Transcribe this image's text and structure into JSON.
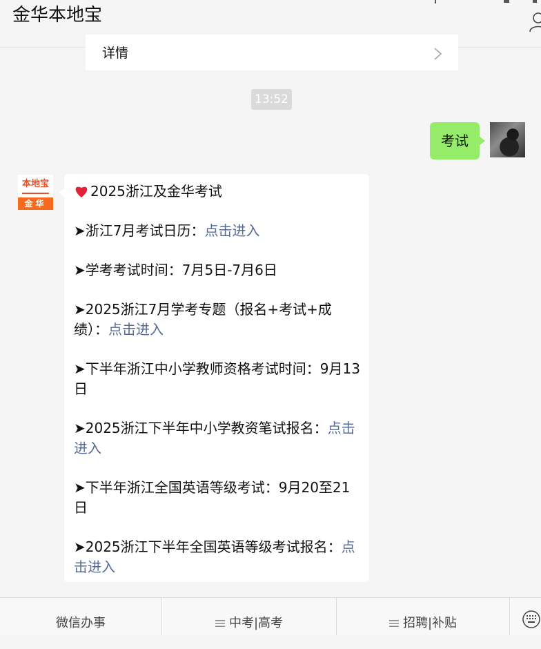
{
  "header": {
    "title": "金华本地宝",
    "profile_icon": "person-icon"
  },
  "details_card": {
    "label": "详情",
    "chevron_icon": "chevron-right-icon"
  },
  "timestamp": "13:52",
  "user_message": {
    "text": "考试",
    "bubble_color": "#95ec69"
  },
  "bot": {
    "avatar_top": "本地宝",
    "avatar_bottom": "金华",
    "heading_icon": "heart-icon",
    "heading": "2025浙江及金华考试",
    "items": [
      {
        "text": "➤浙江7月考试日历：",
        "link": "点击进入"
      },
      {
        "text": "➤学考考试时间：7月5日-7月6日",
        "link": ""
      },
      {
        "text": "➤2025浙江7月学考专题（报名+考试+成绩）：",
        "link": "点击进入"
      },
      {
        "text": "➤下半年浙江中小学教师资格考试时间：9月13日",
        "link": ""
      },
      {
        "text": "➤2025浙江下半年中小学教资笔试报名：",
        "link": "点击进入"
      },
      {
        "text": "➤下半年浙江全国英语等级考试：9月20至21日",
        "link": ""
      },
      {
        "text": "➤2025浙江下半年全国英语等级考试报名：",
        "link": "点击进入"
      }
    ],
    "link_color": "#576b95"
  },
  "bottom_menu": {
    "items": [
      {
        "label": "微信办事",
        "icon": ""
      },
      {
        "label": "中考|高考",
        "icon": "menu-lines-icon"
      },
      {
        "label": "招聘|补贴",
        "icon": "menu-lines-icon"
      }
    ],
    "keyboard_icon": "keyboard-icon"
  }
}
